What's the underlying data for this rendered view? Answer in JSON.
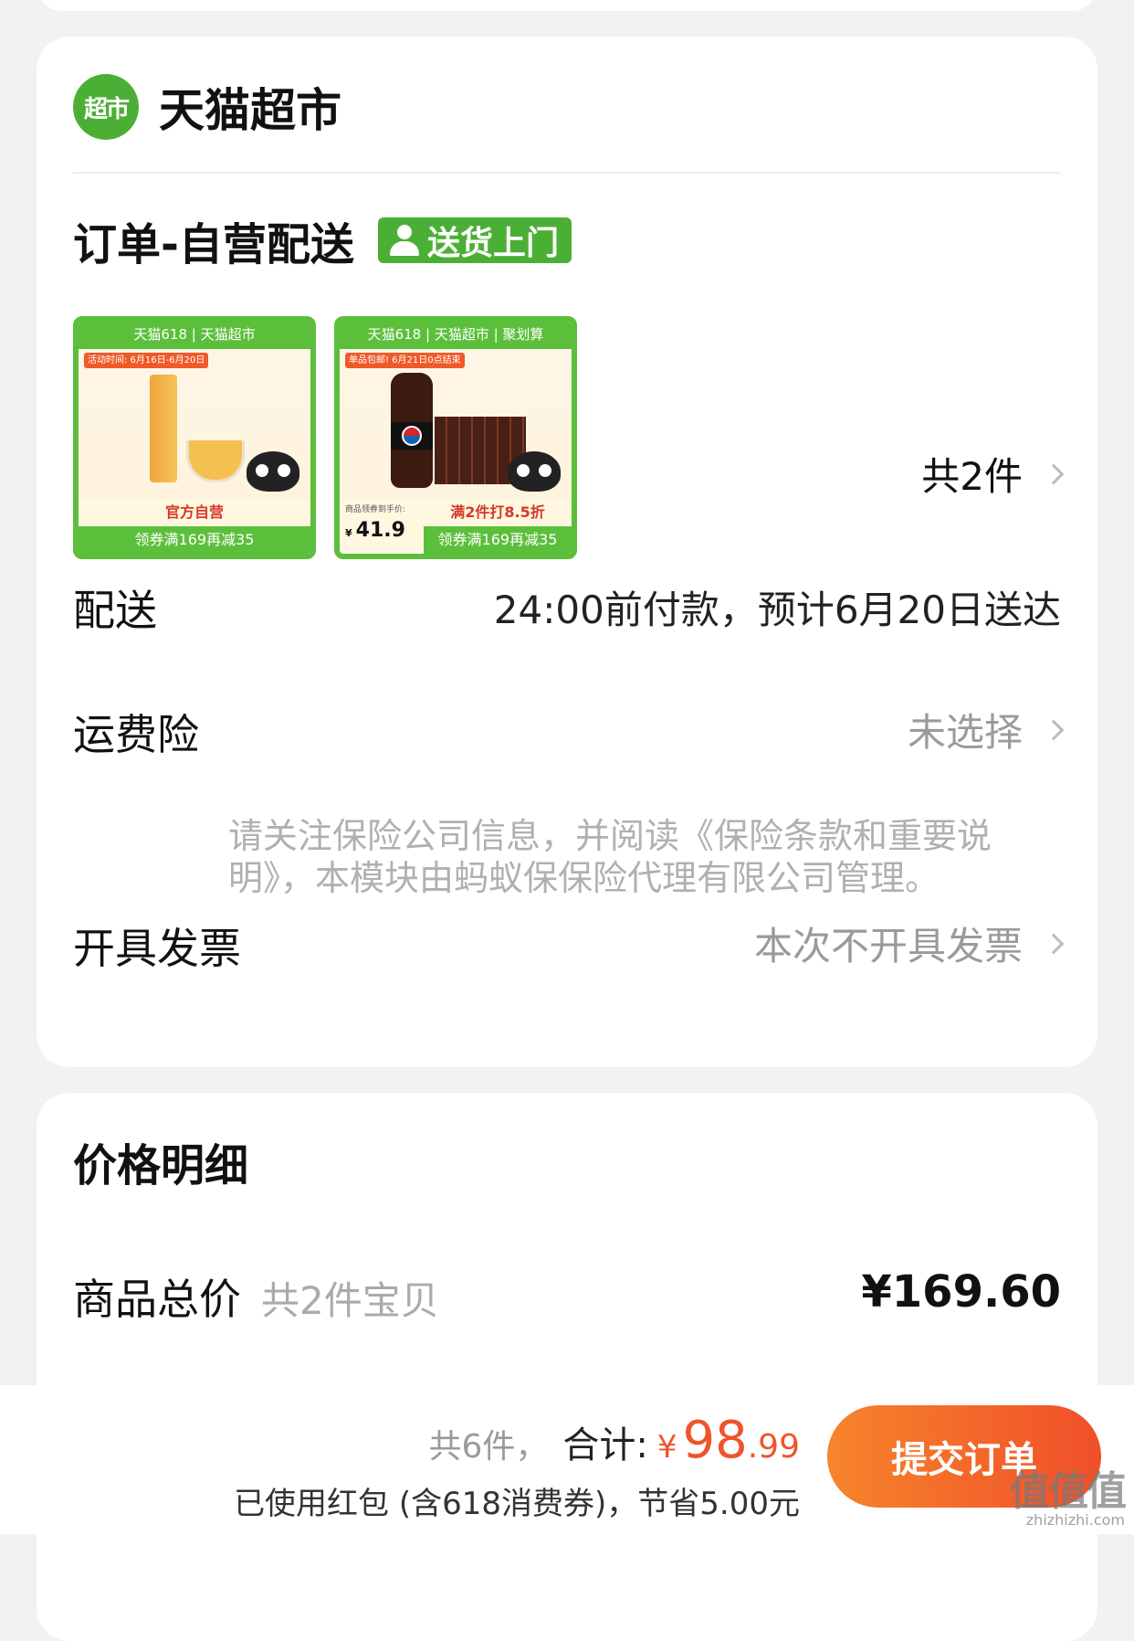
{
  "store": {
    "logo_text": "超市",
    "name": "天猫超市"
  },
  "order": {
    "title": "订单-自营配送",
    "delivery_tag": "送货上门",
    "products": [
      {
        "banner": "天猫618 | 天猫超市",
        "side_tag": "活动时间: 6月16日-6月20日",
        "strip": "官方自营",
        "footer": "领券满169再减35"
      },
      {
        "banner": "天猫618 | 天猫超市 | 聚划算",
        "side_tag": "单品包邮! 6月21日0点结束",
        "price_label": "商品领券到手价:",
        "price_yen": "¥",
        "price": "41.9",
        "strip": "满2件打8.5折",
        "footer": "领券满169再减35"
      }
    ],
    "count_label": "共2件"
  },
  "delivery": {
    "label": "配送",
    "value": "24:00前付款，预计6月20日送达"
  },
  "insurance": {
    "label": "运费险",
    "value": "未选择",
    "note": "请关注保险公司信息，并阅读《保险条款和重要说明》，本模块由蚂蚁保保险代理有限公司管理。"
  },
  "invoice": {
    "label": "开具发票",
    "value": "本次不开具发票"
  },
  "price_detail": {
    "title": "价格明细",
    "goods_total_label": "商品总价",
    "goods_total_sub": "共2件宝贝",
    "goods_total_value": "¥169.60"
  },
  "bottom_bar": {
    "count": "共6件，",
    "total_label": "合计:",
    "yen": "¥",
    "amount_int": "98",
    "amount_dec": ".99",
    "discount_note": "已使用红包 (含618消费券)，节省5.00元",
    "submit_label": "提交订单"
  },
  "watermark": {
    "main": "值值值",
    "sub": "zhizhizhi.com"
  },
  "colors": {
    "brand_green": "#4caf35",
    "accent_orange": "#f0542c"
  }
}
